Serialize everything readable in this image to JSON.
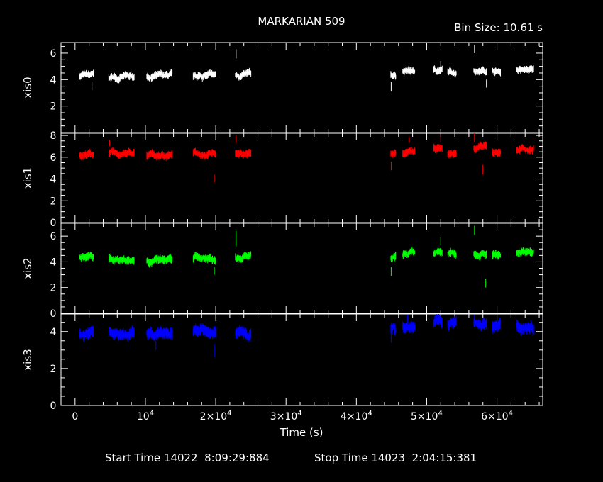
{
  "chart_data": {
    "type": "line",
    "title": "MARKARIAN 509",
    "bin_size_label": "Bin Size: 10.61 s",
    "xlabel": "Time (s)",
    "xlim": [
      -2000,
      66500
    ],
    "xticks": [
      {
        "value": 0,
        "label": "0"
      },
      {
        "value": 10000,
        "label": "10^4"
      },
      {
        "value": 20000,
        "label": "2×10^4"
      },
      {
        "value": 30000,
        "label": "3×10^4"
      },
      {
        "value": 40000,
        "label": "4×10^4"
      },
      {
        "value": 50000,
        "label": "5×10^4"
      },
      {
        "value": 60000,
        "label": "6×10^4"
      }
    ],
    "footer_start": "Start Time 14022  8:09:29:884",
    "footer_stop": "Stop Time 14023  2:04:15:381",
    "segments": [
      [
        600,
        2600
      ],
      [
        4800,
        8400
      ],
      [
        10200,
        13800
      ],
      [
        16800,
        20000
      ],
      [
        22800,
        25000
      ],
      [
        44900,
        45600
      ],
      [
        46600,
        48300
      ],
      [
        51000,
        52200
      ],
      [
        53000,
        54200
      ],
      [
        56700,
        58500
      ],
      [
        59300,
        60500
      ],
      [
        62800,
        65200
      ]
    ],
    "panels": [
      {
        "ylabel": "xis0",
        "color": "#ffffff",
        "ylim": [
          0,
          6.8
        ],
        "yticks": [
          {
            "v": 2,
            "l": "2"
          },
          {
            "v": 4,
            "l": "4"
          },
          {
            "v": 6,
            "l": "6"
          }
        ],
        "levels": [
          4.3,
          4.2,
          4.25,
          4.3,
          4.35,
          4.35,
          4.6,
          4.7,
          4.6,
          4.7,
          4.6,
          4.7
        ],
        "noise": 0.22,
        "spikes": [
          {
            "x": 22900,
            "y1": 5.6,
            "y2": 6.3
          },
          {
            "x": 2400,
            "y1": 3.2,
            "y2": 3.8
          },
          {
            "x": 44950,
            "y1": 3.1,
            "y2": 3.8
          },
          {
            "x": 52000,
            "y1": 4.8,
            "y2": 5.4
          },
          {
            "x": 56800,
            "y1": 6.0,
            "y2": 6.6
          },
          {
            "x": 58500,
            "y1": 3.4,
            "y2": 4.0
          }
        ]
      },
      {
        "ylabel": "xis1",
        "color": "#ff0000",
        "ylim": [
          0,
          8.2
        ],
        "yticks": [
          {
            "v": 0,
            "l": "0"
          },
          {
            "v": 2,
            "l": "2"
          },
          {
            "v": 4,
            "l": "4"
          },
          {
            "v": 6,
            "l": "6"
          },
          {
            "v": 8,
            "l": "8"
          }
        ],
        "levels": [
          6.3,
          6.3,
          6.2,
          6.4,
          6.3,
          6.3,
          6.4,
          6.8,
          6.3,
          6.9,
          6.5,
          6.7
        ],
        "noise": 0.28,
        "spikes": [
          {
            "x": 22900,
            "y1": 7.3,
            "y2": 8.0
          },
          {
            "x": 19800,
            "y1": 3.7,
            "y2": 4.4
          },
          {
            "x": 4900,
            "y1": 7.0,
            "y2": 7.6
          },
          {
            "x": 44950,
            "y1": 4.8,
            "y2": 5.6
          },
          {
            "x": 47500,
            "y1": 7.3,
            "y2": 7.9
          },
          {
            "x": 52000,
            "y1": 7.4,
            "y2": 8.1
          },
          {
            "x": 56800,
            "y1": 7.4,
            "y2": 8.2
          },
          {
            "x": 58000,
            "y1": 4.4,
            "y2": 5.3
          }
        ]
      },
      {
        "ylabel": "xis2",
        "color": "#00ff00",
        "ylim": [
          0,
          7.0
        ],
        "yticks": [
          {
            "v": 0,
            "l": "0"
          },
          {
            "v": 2,
            "l": "2"
          },
          {
            "v": 4,
            "l": "4"
          },
          {
            "v": 6,
            "l": "6"
          }
        ],
        "levels": [
          4.4,
          4.2,
          4.1,
          4.3,
          4.4,
          4.3,
          4.6,
          4.7,
          4.6,
          4.6,
          4.6,
          4.7
        ],
        "noise": 0.25,
        "spikes": [
          {
            "x": 22900,
            "y1": 5.2,
            "y2": 6.4
          },
          {
            "x": 19800,
            "y1": 3.0,
            "y2": 3.6
          },
          {
            "x": 44950,
            "y1": 2.9,
            "y2": 3.6
          },
          {
            "x": 52000,
            "y1": 5.3,
            "y2": 5.9
          },
          {
            "x": 56800,
            "y1": 6.1,
            "y2": 6.8
          },
          {
            "x": 58400,
            "y1": 2.0,
            "y2": 2.7
          }
        ]
      },
      {
        "ylabel": "xis3",
        "color": "#0000ff",
        "ylim": [
          0,
          4.95
        ],
        "yticks": [
          {
            "v": 0,
            "l": "0"
          },
          {
            "v": 2,
            "l": "2"
          },
          {
            "v": 4,
            "l": "4"
          }
        ],
        "levels": [
          3.9,
          3.95,
          3.85,
          4.0,
          3.9,
          4.1,
          4.3,
          4.5,
          4.4,
          4.5,
          4.3,
          4.3
        ],
        "noise": 0.24,
        "spikes": [
          {
            "x": 19800,
            "y1": 2.6,
            "y2": 3.3
          },
          {
            "x": 11500,
            "y1": 3.0,
            "y2": 3.5
          },
          {
            "x": 44950,
            "y1": 3.4,
            "y2": 4.0
          },
          {
            "x": 47300,
            "y1": 4.5,
            "y2": 4.9
          },
          {
            "x": 51800,
            "y1": 4.5,
            "y2": 4.9
          },
          {
            "x": 56800,
            "y1": 4.4,
            "y2": 4.9
          }
        ]
      }
    ]
  }
}
